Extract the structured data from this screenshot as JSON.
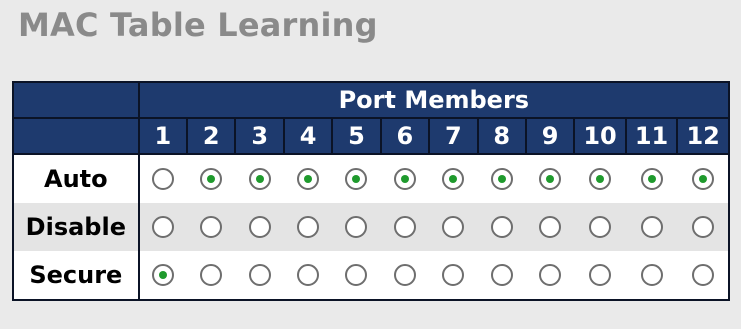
{
  "title": "MAC Table Learning",
  "header": {
    "group_label": "Port Members",
    "ports": [
      "1",
      "2",
      "3",
      "4",
      "5",
      "6",
      "7",
      "8",
      "9",
      "10",
      "11",
      "12"
    ]
  },
  "rows": [
    {
      "label": "Auto",
      "values": [
        false,
        true,
        true,
        true,
        true,
        true,
        true,
        true,
        true,
        true,
        true,
        true
      ]
    },
    {
      "label": "Disable",
      "values": [
        false,
        false,
        false,
        false,
        false,
        false,
        false,
        false,
        false,
        false,
        false,
        false
      ]
    },
    {
      "label": "Secure",
      "values": [
        true,
        false,
        false,
        false,
        false,
        false,
        false,
        false,
        false,
        false,
        false,
        false
      ]
    }
  ],
  "colors": {
    "header_bg": "#1e3a6e",
    "header_text": "#ffffff",
    "title_text": "#8a8a8a",
    "radio_checked": "#1f9a2d",
    "row_alt_bg": "#e4e4e4"
  }
}
